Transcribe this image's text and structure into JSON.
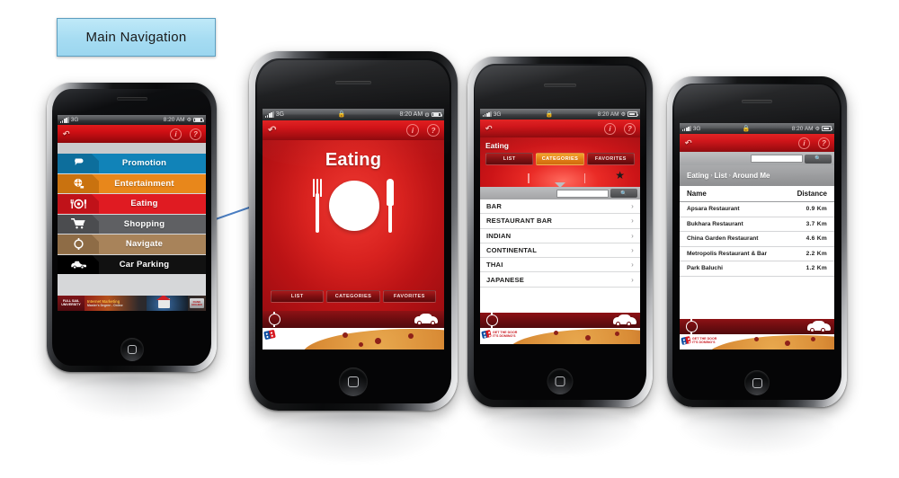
{
  "callout": {
    "label": "Main Navigation"
  },
  "status_bar": {
    "carrier": "3G",
    "time": "8:20 AM",
    "lock_icon": "lock-icon",
    "battery_icon": "battery-icon",
    "gear_icon": "gear-icon"
  },
  "app_nav": {
    "back_icon": "back-arrow-icon",
    "info_label": "i",
    "help_label": "?"
  },
  "toolbar": {
    "settings_icon": "gear-icon",
    "car_icon": "car-icon"
  },
  "ad_banner": {
    "brand": "FULL SAIL UNIVERSITY",
    "headline": "Internet Marketing",
    "subline": "Master's Degree - Online",
    "cta": "Find Out More",
    "chip": "RANK HIGHER"
  },
  "dominos_banner": {
    "line1": "GET THE DOOR",
    "line2": "IT'S DOMINO'S"
  },
  "phone1": {
    "menu": [
      {
        "label": "Promotion",
        "icon": "tag-icon",
        "color": "#1183b8"
      },
      {
        "label": "Entertainment",
        "icon": "film-reel-icon",
        "color": "#e8871b"
      },
      {
        "label": "Eating",
        "icon": "cutlery-icon",
        "color": "#e01b22"
      },
      {
        "label": "Shopping",
        "icon": "shopping-cart-icon",
        "color": "#5f6063"
      },
      {
        "label": "Navigate",
        "icon": "compass-icon",
        "color": "#a8835a"
      },
      {
        "label": "Car Parking",
        "icon": "car-icon",
        "color": "#111111"
      }
    ]
  },
  "phone2": {
    "title": "Eating",
    "hero_icon": "plate-fork-knife-icon",
    "segments": [
      {
        "label": "LIST",
        "active": false
      },
      {
        "label": "CATEGORIES",
        "active": false
      },
      {
        "label": "FAVORITES",
        "active": false
      }
    ]
  },
  "phone3": {
    "header": "Eating",
    "segments": [
      {
        "label": "LIST",
        "active": false
      },
      {
        "label": "CATEGORIES",
        "active": true
      },
      {
        "label": "FAVORITES",
        "active": false
      }
    ],
    "favorite_icon": "star-icon",
    "search": {
      "value": "",
      "placeholder": "",
      "button_icon": "search-icon"
    },
    "categories": [
      {
        "label": "BAR"
      },
      {
        "label": "RESTAURANT BAR"
      },
      {
        "label": "INDIAN"
      },
      {
        "label": "CONTINENTAL"
      },
      {
        "label": "THAI"
      },
      {
        "label": "JAPANESE"
      }
    ],
    "chevron": "›"
  },
  "phone4": {
    "search": {
      "value": "",
      "placeholder": "",
      "button_icon": "search-icon"
    },
    "breadcrumb": {
      "items": [
        "Eating",
        "List",
        "Around Me"
      ],
      "separator": "›"
    },
    "table": {
      "columns": [
        "Name",
        "Distance"
      ],
      "rows": [
        {
          "name": "Apsara Restaurant",
          "distance": "0.9  Km"
        },
        {
          "name": "Bukhara Restaurant",
          "distance": "3.7  Km"
        },
        {
          "name": "China Garden Restaurant",
          "distance": "4.6  Km"
        },
        {
          "name": "Metropolis Restaurant & Bar",
          "distance": "2.2  Km"
        },
        {
          "name": "Park Baluchi",
          "distance": "1.2  Km"
        }
      ]
    }
  },
  "colors": {
    "brand_red": "#cf1317",
    "accent_orange": "#e07d14",
    "callout_blue": "#a6dcf2"
  }
}
